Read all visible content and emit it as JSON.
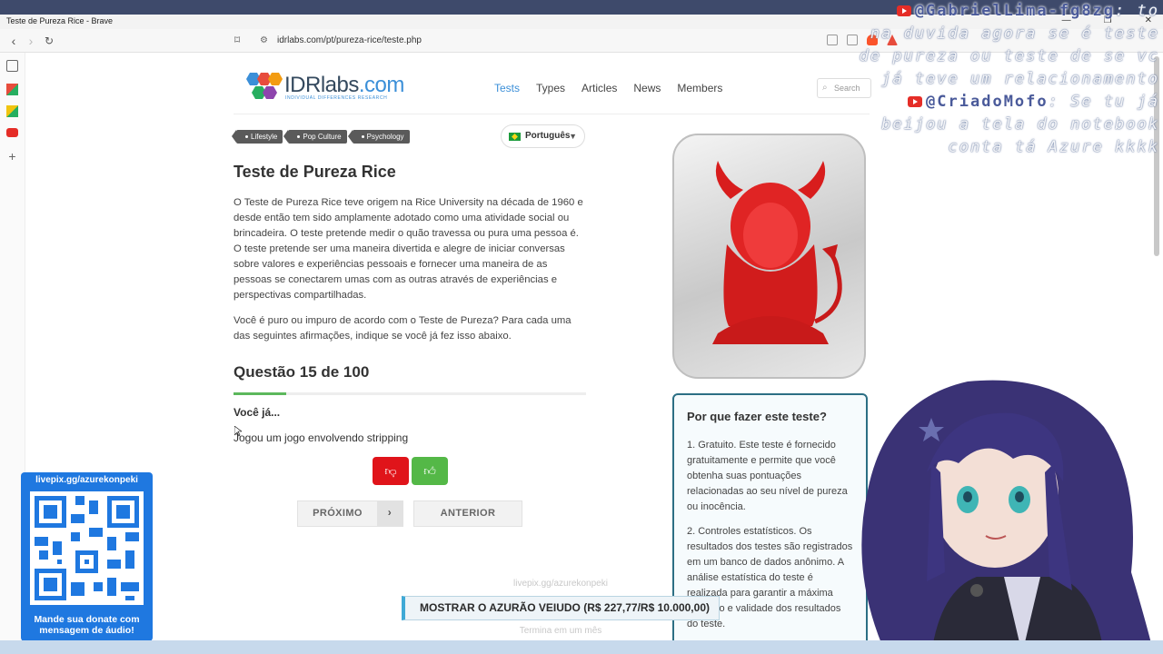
{
  "window": {
    "title": "Teste de Pureza Rice - Brave",
    "minimize": "—",
    "maximize": "❐",
    "close": "✕"
  },
  "browser": {
    "url": "idrlabs.com/pt/pureza-rice/teste.php"
  },
  "site": {
    "logo_main": "IDRlabs",
    "logo_tld": ".com",
    "logo_sub": "INDIVIDUAL DIFFERENCES RESEARCH",
    "nav": [
      "Tests",
      "Types",
      "Articles",
      "News",
      "Members"
    ],
    "active_nav": "Tests",
    "search_placeholder": "Search"
  },
  "tags": [
    "Lifestyle",
    "Pop Culture",
    "Psychology"
  ],
  "language": "Português",
  "article": {
    "title": "Teste de Pureza Rice",
    "paragraph_1": "O Teste de Pureza Rice teve origem na Rice University na década de 1960 e desde então tem sido amplamente adotado como uma atividade social ou brincadeira. O teste pretende medir o quão travessa ou pura uma pessoa é. O teste pretende ser uma maneira divertida e alegre de iniciar conversas sobre valores e experiências pessoais e fornecer uma maneira de as pessoas se conectarem umas com as outras através de experiências e perspectivas compartilhadas.",
    "paragraph_2": "Você é puro ou impuro de acordo com o Teste de Pureza? Para cada uma das seguintes afirmações, indique se você já fez isso abaixo."
  },
  "quiz": {
    "counter": "Questão 15 de 100",
    "progress": 0.15,
    "lead": "Você já...",
    "statement": "Jogou um jogo envolvendo stripping",
    "next_label": "PRÓXIMO",
    "prev_label": "ANTERIOR"
  },
  "why": {
    "title": "Por que fazer este teste?",
    "item_1": "1. Gratuito. Este teste é fornecido gratuitamente e permite que você obtenha suas pontuações relacionadas ao seu nível de pureza ou inocência.",
    "item_2": "2. Controles estatísticos. Os resultados dos testes são registrados em um banco de dados anônimo. A análise estatística do teste é realizada para garantir a máxima precisão e validade dos resultados do teste."
  },
  "overlay": {
    "handle_1": "@GabrielLima-fg8zg",
    "chat_1": [
      "to",
      "na duvida agora se é teste",
      "de pureza ou teste de se vc",
      "já teve um relacionamento"
    ],
    "handle_2": "@CriadoMofo",
    "chat_2": [
      ": Se tu já",
      "beijou a tela do notebook",
      "conta tá Azure kkkk"
    ],
    "donate_url": "livepix.gg/azurekonpeki",
    "donate_caption_1": "Mande sua donate com",
    "donate_caption_2": "mensagem de áudio!",
    "goal_faint_top": "livepix.gg/azurekonpeki",
    "goal_text": "MOSTRAR O AZURÃO VEIUDO (R$ 227,77/R$ 10.000,00)",
    "goal_faint_bottom": "Termina em um mês"
  },
  "colors": {
    "accent": "#3b8fd8",
    "no_button": "#e0141a",
    "yes_button": "#54b847",
    "progress": "#5cb85c",
    "why_border": "#2c6f84",
    "donate_panel": "#1f78e0"
  }
}
